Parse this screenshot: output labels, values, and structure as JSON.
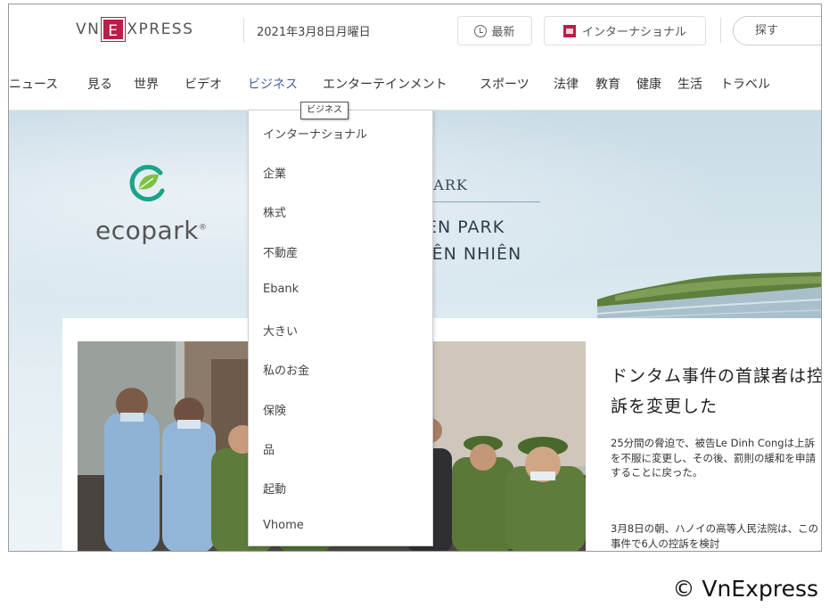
{
  "header": {
    "logo_left": "VN",
    "logo_mark": "E",
    "logo_right": "XPRESS",
    "date": "2021年3月8日月曜日",
    "latest_label": "最新",
    "international_label": "インターナショナル",
    "search_placeholder": "探す"
  },
  "nav": {
    "items": [
      "ニュース",
      "見る",
      "世界",
      "ビデオ",
      "ビジネス",
      "エンターテインメント",
      "スポーツ",
      "法律",
      "教育",
      "健康",
      "生活",
      "トラベル"
    ],
    "active_index": 4
  },
  "tooltip": "ビジネス",
  "dropdown": {
    "items": [
      "インターナショナル",
      "企業",
      "株式",
      "不動産",
      "Ebank",
      "大きい",
      "私のお金",
      "保険",
      "品",
      "起動",
      "Vhome"
    ]
  },
  "banner": {
    "brand": "ecopark",
    "line1": "PARK",
    "line2": "EN PARK",
    "line3": "IÊN NHIÊN"
  },
  "article": {
    "headline": "ドンタム事件の首謀者は控訴を変更した",
    "body1": "25分間の脅迫で、被告Le Dinh Congは上訴を不服に変更し、その後、罰則の緩和を申請することに戻った。",
    "body2": "3月8日の朝、ハノイの高等人民法院は、この事件で6人の控訴を検討"
  },
  "credit": "© VnExpress",
  "colors": {
    "brand": "#b5214a",
    "nav_active": "#4a5ea0"
  }
}
